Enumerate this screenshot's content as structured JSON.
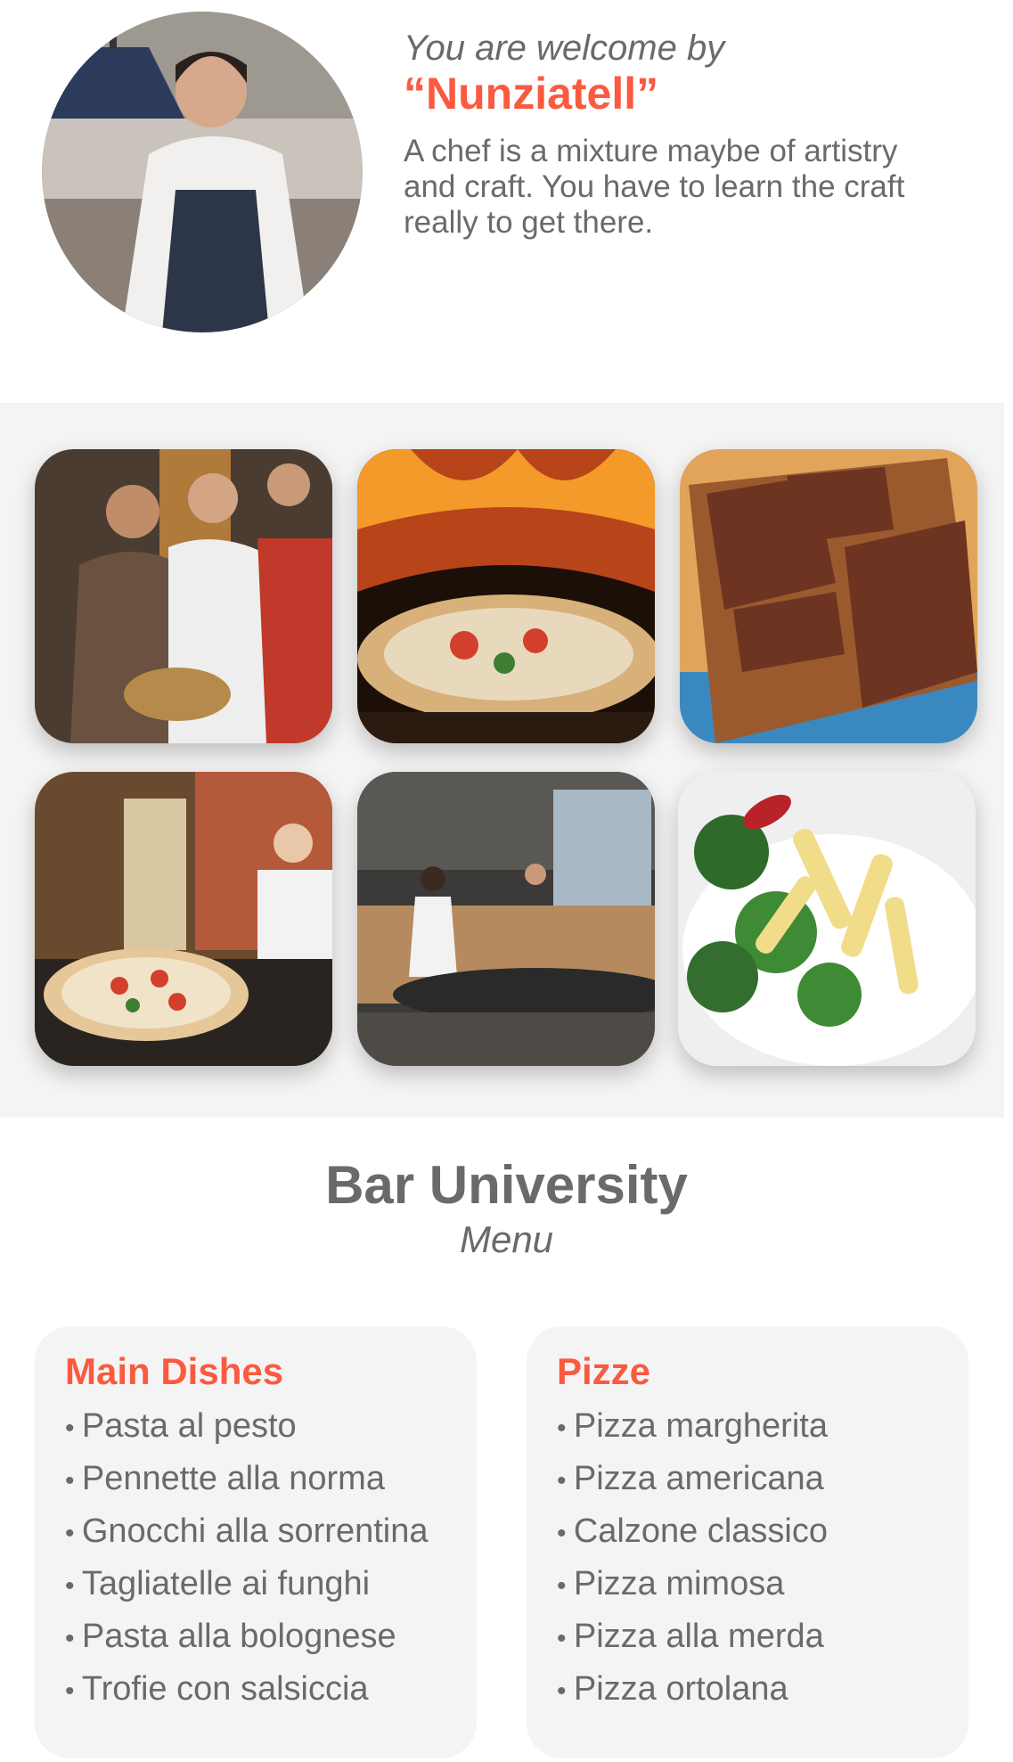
{
  "hero": {
    "welcome": "You are welcome by",
    "chef_name": "“Nunziatell”",
    "quote": "A chef is a mixture maybe of artistry and craft. You have to learn the craft really to get there."
  },
  "gallery": {
    "photos": [
      "group-photo",
      "pizza-in-oven",
      "lahmacun-board",
      "pizza-and-baker",
      "restaurant-interior",
      "pasta-broccoli"
    ]
  },
  "menu": {
    "title": "Bar University",
    "subtitle": "Menu",
    "sections": [
      {
        "title": "Main Dishes",
        "items": [
          "Pasta al pesto",
          "Pennette alla norma",
          "Gnocchi alla sorrentina",
          "Tagliatelle ai funghi",
          "Pasta alla bolognese",
          "Trofie con salsiccia"
        ]
      },
      {
        "title": "Pizze",
        "items": [
          "Pizza margherita",
          "Pizza americana",
          "Calzone classico",
          "Pizza mimosa",
          "Pizza alla merda",
          "Pizza ortolana"
        ]
      }
    ]
  },
  "colors": {
    "accent": "#fa5a40",
    "text": "#6a6a6a",
    "panel": "#f4f4f4"
  }
}
